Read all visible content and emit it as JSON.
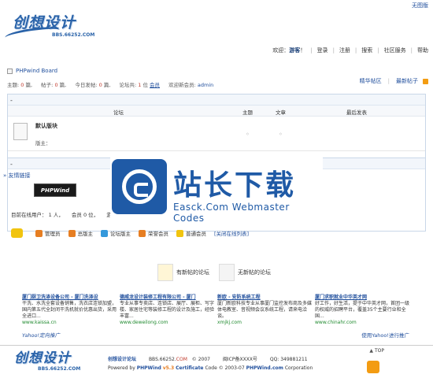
{
  "top_right": {
    "no_image": "无图版"
  },
  "logo": {
    "title": "创想设计",
    "url": "BBS.66252.COM"
  },
  "topnav": {
    "welcome_prefix": "欢迎：",
    "guest": "游客",
    "welcome_suffix": "！",
    "items": [
      "登录",
      "注册",
      "搜索",
      "社区服务",
      "帮助"
    ]
  },
  "board": {
    "title": "PHPwind Board"
  },
  "stats": {
    "topics_label": "主题:",
    "topics": "0",
    "topics_unit": "篇,",
    "posts_label": "帖子:",
    "posts": "0",
    "posts_unit": "篇,",
    "today_label": "今日发帖:",
    "today": "0",
    "today_unit": "篇,",
    "members_label": "论坛共:",
    "members": "1",
    "members_unit": "位",
    "members_link": "会员",
    "newest_label": "欢迎新会员:",
    "newest": "admin"
  },
  "right_links": {
    "digest": "精华帖区",
    "latest": "最新帖子"
  },
  "forum_table": {
    "headers": {
      "forum": "论坛",
      "topics": "主题",
      "articles": "文章",
      "last_post": "最后发表"
    },
    "rows": [
      {
        "name": "默认版块",
        "moderator": "版主：",
        "topics": "◦",
        "articles": "◦"
      }
    ]
  },
  "friends": {
    "label": "» 友情链接",
    "phpwind_logo": "PHPWind"
  },
  "online": {
    "text_prefix": "目前在线用户：",
    "users": "1",
    "users_unit": "人，",
    "members_prefix": "会员",
    "members": "0",
    "members_unit": "位，",
    "guests_prefix": "游客"
  },
  "legend": {
    "items": [
      {
        "label": "管理员",
        "color": "#e67e22"
      },
      {
        "label": "总版主",
        "color": "#e67e22"
      },
      {
        "label": "论坛版主",
        "color": "#3498db"
      },
      {
        "label": "荣誉会员",
        "color": "#e67e22"
      },
      {
        "label": "普通会员",
        "color": "#f1c40f"
      }
    ],
    "close_list": "[关闭在线列表]"
  },
  "watermark": {
    "title": "站长下载",
    "subtitle": "Easck.Com Webmaster Codes"
  },
  "post_legend": {
    "new": "有新帖的论坛",
    "none": "无新帖的论坛"
  },
  "ads": [
    {
      "title": "厦门厨卫洗涤设备公司 - 厦门洗涤设",
      "body": "干洗、水洗全套设备销售，洗衣店连锁加盟，国内第五代全封闭干洗机就价优惠出货，采用全进口...",
      "url": "www.kaissa.cn"
    },
    {
      "title": "德威龙设计装修工程有限公司 - 厦门",
      "body": "专业从事专卖店、连锁店、展厅、展柜、写字楼、家居住宅等装修工程的设计及施工，经验丰富...",
      "url": "www.deweilong.com"
    },
    {
      "title": "新欧 - 安防系统工程",
      "body": "厦门新欧科技专业从事厦门监控发布商及多媒体电教室、音视频会议系统工程，请来电洽谈。",
      "url": "xmjkj.com"
    },
    {
      "title": "厦门求职就业中华英才网",
      "body": "好工作，好生活，提于中华英才网，首团一级的权威的招聘平台，覆盖35个主要行业和全国...",
      "url": "www.chinahr.com"
    }
  ],
  "yahoo": {
    "left": "Yahoo!定向推广",
    "right": "使用Yahoo!进行推广"
  },
  "footer": {
    "site_name": "创想设计论坛",
    "domain_prefix": "BBS.66252.",
    "domain_suffix": "COM",
    "year": "© 2007",
    "icp": "闽ICP备XXXX号",
    "qq": "QQ: 349881211",
    "powered_by": "Powered by",
    "brand": "PHPWind",
    "version": "v5.3",
    "cert": "Certificate",
    "code_text": "Code © 2003-07",
    "brand_site": "PHPWind.com",
    "corp": "Corporation",
    "top_label": "TOP"
  }
}
